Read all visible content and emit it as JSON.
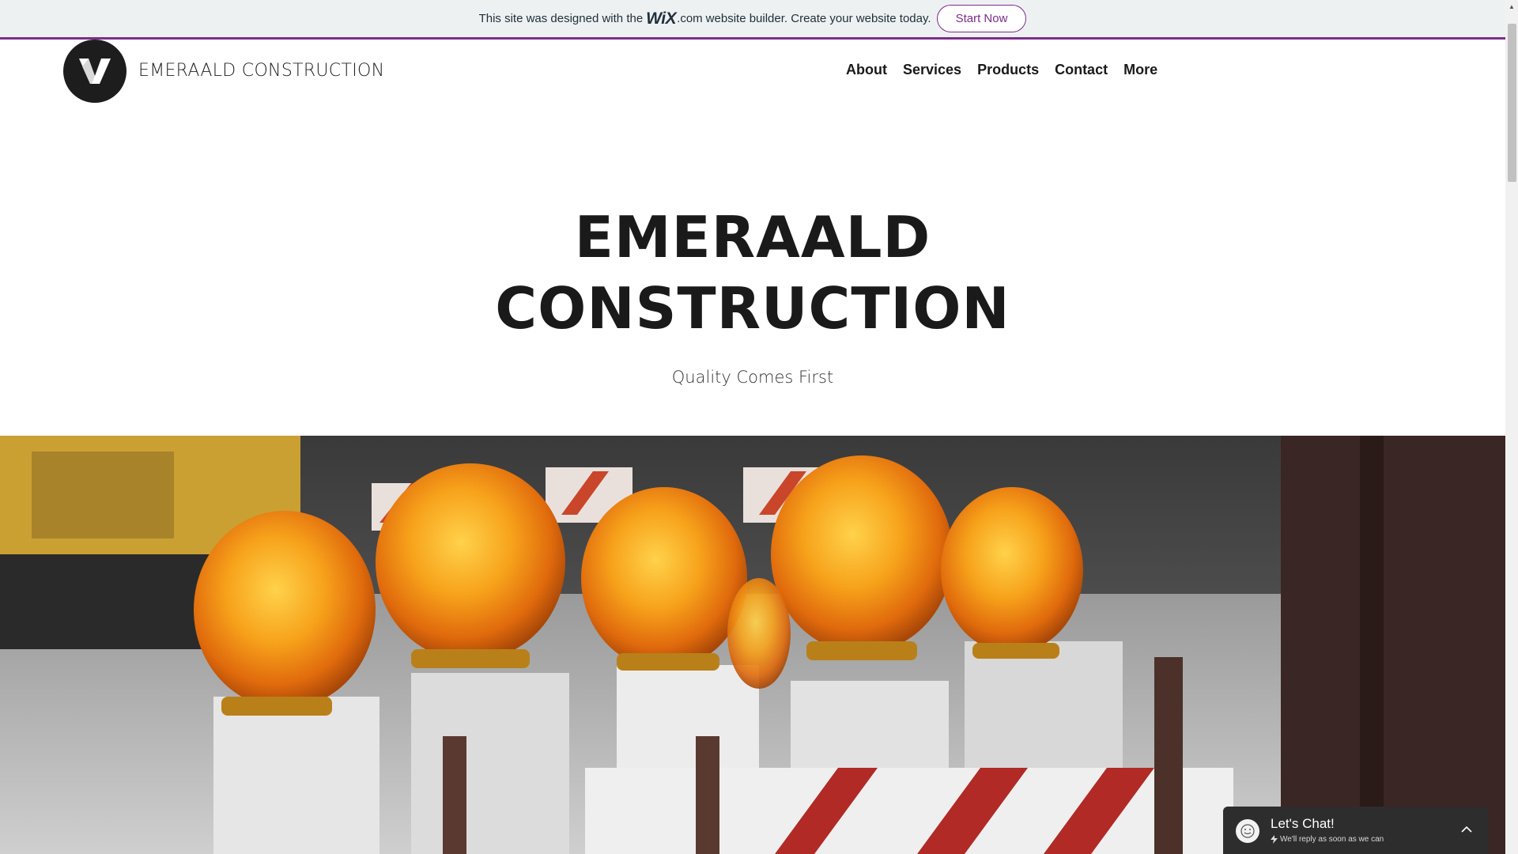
{
  "banner": {
    "text_before": "This site was designed with the",
    "wix_logo": "WiX",
    "dotcom": ".com",
    "text_after": "website builder. Create your website today.",
    "button_label": "Start Now"
  },
  "header": {
    "logo_letter": "V",
    "site_name": "EMERAALD CONSTRUCTION",
    "nav": [
      "About",
      "Services",
      "Products",
      "Contact",
      "More"
    ]
  },
  "hero": {
    "title_line1": "EMERAALD",
    "title_line2": "CONSTRUCTION",
    "subtitle": "Quality Comes First"
  },
  "chat": {
    "title": "Let's Chat!",
    "subtitle": "We'll reply as soon as we can"
  },
  "icons": {
    "logo": "v-logo-icon",
    "chat_avatar": "smiley-icon",
    "chat_bolt": "lightning-icon",
    "chat_toggle": "chevron-up-icon",
    "scroll_up": "arrow-up-icon"
  },
  "colors": {
    "accent": "#7b2d8b",
    "banner_bg": "#eef1f2",
    "logo_bg": "#1d1d1d",
    "chat_bg": "#2d2d2d"
  }
}
